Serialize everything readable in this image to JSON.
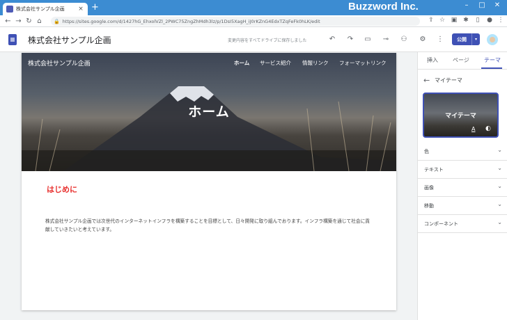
{
  "browser": {
    "tab_title": "株式会社サンプル企画",
    "tab_close": "×",
    "new_tab": "+",
    "brand_overlay": "Buzzword Inc.",
    "window_controls": {
      "minimize": "–",
      "maximize": "□",
      "close": "✕"
    },
    "url": "https://sites.google.com/d/1427hG_EhxolVZl_2PWC75ZngZhMdh3lz/p/1DsI5XagH_iJ0rKZnG4EdxTZqFeFk0hLK/edit",
    "nav": {
      "back": "←",
      "forward": "→",
      "reload": "↻",
      "home": "⌂"
    },
    "lock_icon": "🔒"
  },
  "editor": {
    "site_name": "株式会社サンプル企画",
    "save_status": "変更内容をすべてドライブに保存しました",
    "publish_label": "公開",
    "publish_dropdown": "▾"
  },
  "site": {
    "header_title": "株式会社サンプル企画",
    "nav": [
      "ホーム",
      "サービス紹介",
      "情報リンク",
      "フォーマットリンク"
    ],
    "hero_title": "ホーム",
    "section_heading": "はじめに",
    "body": "株式会社サンプル企画では次世代のインターネットインフラを構築することを目標として、日々開発に取り組んでおります。インフラ構築を通じて社会に貢献していきたいと考えています。"
  },
  "panel": {
    "tabs": [
      "挿入",
      "ページ",
      "テーマ"
    ],
    "active_tab": "テーマ",
    "back_icon": "←",
    "theme_name": "マイテーマ",
    "theme_card_title": "マイテーマ",
    "theme_font_icon": "A",
    "theme_palette_icon": "◐",
    "sections": [
      "色",
      "テキスト",
      "画像",
      "移動",
      "コンポーネント"
    ],
    "chevron": "⌄"
  },
  "colors": {
    "browser_accent": "#3c8cd2",
    "publish_button": "#3f51b5",
    "heading_red": "#e8312f",
    "active_tab": "#3f51b5"
  }
}
